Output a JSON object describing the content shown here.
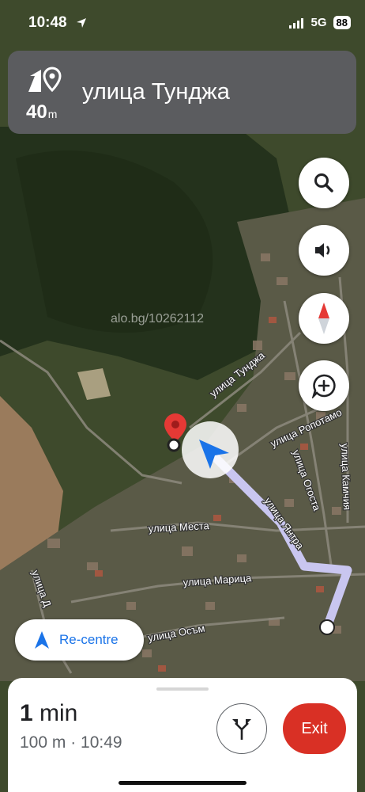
{
  "status_bar": {
    "time": "10:48",
    "network": "5G",
    "battery": "88"
  },
  "guidance": {
    "distance": "40",
    "distance_unit": "m",
    "street": "улица Тунджа"
  },
  "map": {
    "watermark": "alo.bg/10262112",
    "streets": [
      "улица Тунджа",
      "улица Ропотамо",
      "улица Огоста",
      "улица Камчия",
      "улица Янтра",
      "улица Места",
      "улица Марица",
      "улица Осъм",
      "улица Д"
    ]
  },
  "controls": {
    "search_icon": "search-icon",
    "sound_icon": "volume-icon",
    "compass_icon": "compass-icon",
    "report_icon": "add-report-icon",
    "recentre_label": "Re-centre"
  },
  "trip": {
    "time_value": "1",
    "time_unit": "min",
    "details": "100 m · 10:49",
    "exit_label": "Exit"
  },
  "colors": {
    "accent": "#1a73e8",
    "exit": "#d93025",
    "route": "#c9c6f0"
  }
}
